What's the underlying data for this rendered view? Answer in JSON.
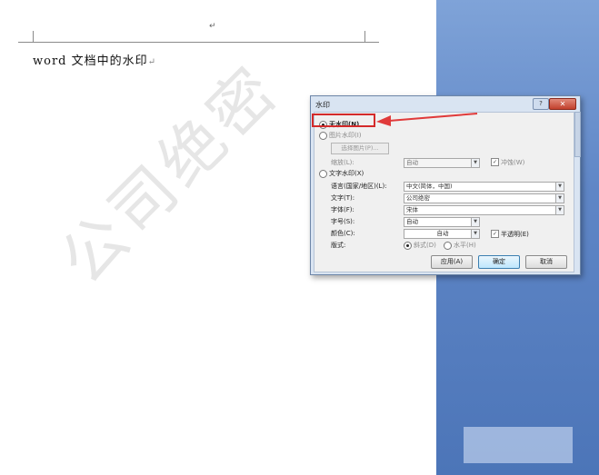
{
  "document": {
    "text": "word 文档中的水印",
    "paragraph_mark": "↵",
    "header_mark": "↵",
    "watermark_text": "公司绝密"
  },
  "dialog": {
    "title": "水印",
    "help_label": "?",
    "close_label": "✕",
    "no_watermark": {
      "label": "无水印(N)",
      "selected": true
    },
    "picture_watermark": {
      "label": "图片水印(I)",
      "select_picture_button": "选择图片(P)...",
      "scale_label": "缩放(L):",
      "scale_value": "自动",
      "washout_label": "冲蚀(W)",
      "washout_checked": true
    },
    "text_watermark": {
      "label": "文字水印(X)",
      "language_label": "语言(国家/地区)(L):",
      "language_value": "中文(简体，中国)",
      "text_label": "文字(T):",
      "text_value": "公司绝密",
      "font_label": "字体(F):",
      "font_value": "宋体",
      "size_label": "字号(S):",
      "size_value": "自动",
      "color_label": "颜色(C):",
      "color_value": "自动",
      "semitransparent_label": "半透明(E)",
      "semitransparent_checked": true,
      "layout_label": "版式:",
      "layout_diagonal": "斜式(D)",
      "layout_horizontal": "水平(H)",
      "layout_selected": "diagonal"
    },
    "buttons": {
      "apply": "应用(A)",
      "ok": "确定",
      "cancel": "取消"
    }
  },
  "colors": {
    "highlight": "#d42a2a",
    "sidebar": "#5f86c6",
    "dialog_frame": "#d9e4f2"
  },
  "icons": {
    "dropdown": "chevron-down-icon",
    "close": "close-icon",
    "help": "help-icon",
    "arrow": "arrow-left-icon"
  }
}
